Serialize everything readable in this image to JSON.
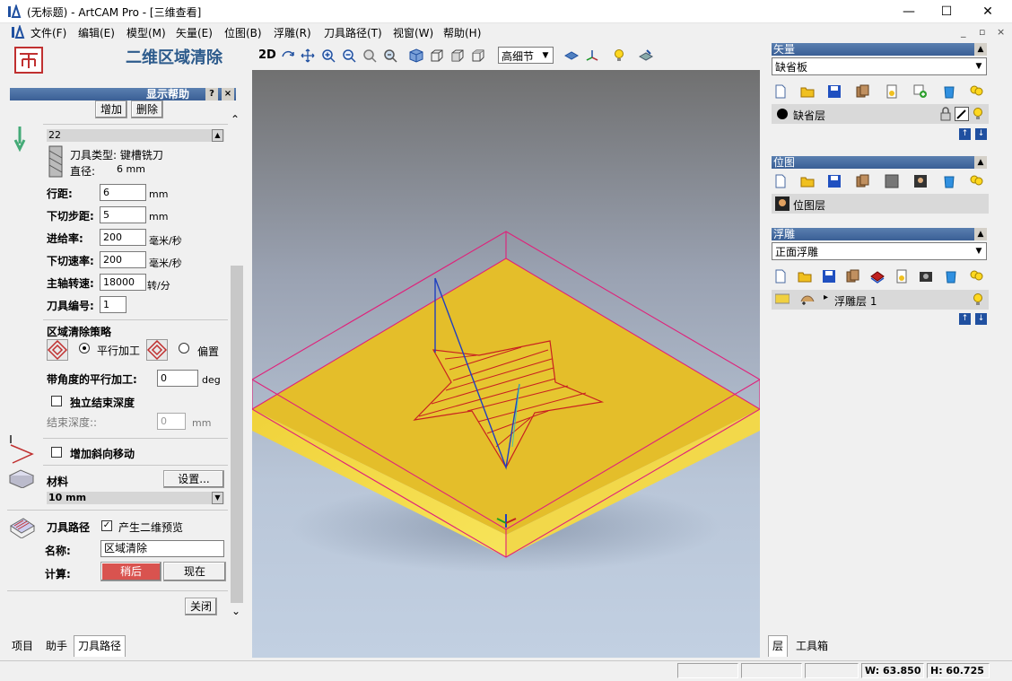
{
  "window": {
    "title": "(无标题) - ArtCAM Pro - [三维查看]",
    "minimize": "—",
    "maximize": "☐",
    "close": "✕"
  },
  "menu": {
    "items": [
      "文件(F)",
      "编辑(E)",
      "模型(M)",
      "矢量(E)",
      "位图(B)",
      "浮雕(R)",
      "刀具路径(T)",
      "视窗(W)",
      "帮助(H)"
    ],
    "mdi": [
      "_",
      "▫",
      "×"
    ]
  },
  "left": {
    "panel_title": "二维区域清除",
    "help_label": "显示帮助",
    "help_q": "?",
    "help_x": "×",
    "add_label": "增加",
    "delete_label": "删除",
    "tool_name": "22",
    "tool_type": "刀具类型: 键槽铣刀",
    "diameter_label": "直径:",
    "diameter_value": "6 mm",
    "stepover_label": "行距:",
    "stepover_value": "6",
    "stepover_unit": "mm",
    "stepdown_label": "下切步距:",
    "stepdown_value": "5",
    "stepdown_unit": "mm",
    "feed_label": "进给率:",
    "feed_value": "200",
    "feed_unit": "毫米/秒",
    "plunge_label": "下切速率:",
    "plunge_value": "200",
    "plunge_unit": "毫米/秒",
    "spindle_label": "主轴转速:",
    "spindle_value": "18000",
    "spindle_unit": "转/分",
    "toolno_label": "刀具编号:",
    "toolno_value": "1",
    "strategy_label": "区域清除策略",
    "raster_label": "平行加工",
    "offset_label": "偏置",
    "angle_label": "带角度的平行加工:",
    "angle_value": "0",
    "angle_unit": "deg",
    "indep_depth_label": "独立结束深度",
    "end_depth_label": "结束深度::",
    "end_depth_value": "0",
    "end_depth_unit": "mm",
    "ramp_label": "增加斜向移动",
    "material_label": "材料",
    "setup_label": "设置...",
    "material_value": "10 mm",
    "toolpath_label": "刀具路径",
    "preview_label": "产生二维预览",
    "name_label": "名称:",
    "name_value": "区域清除",
    "calc_label": "计算:",
    "later_label": "稍后",
    "now_label": "现在",
    "close_label": "关闭"
  },
  "left_tabs": [
    "项目",
    "助手",
    "刀具路径"
  ],
  "toolbar3d": {
    "mode_2d": "2D",
    "quality_value": "高细节"
  },
  "right": {
    "vector_title": "矢量",
    "vector_sheet": "缺省板",
    "vector_layer": "缺省层",
    "bitmap_title": "位图",
    "bitmap_layer": "位图层",
    "relief_title": "浮雕",
    "relief_mode": "正面浮雕",
    "relief_layer": "浮雕层 1"
  },
  "right_tabs": [
    "层",
    "工具箱"
  ],
  "status": {
    "width": "W: 63.850",
    "height": "H: 60.725"
  },
  "colors": {
    "later_button": "#d9534f",
    "panel_title": "#2d5b8c",
    "plate": "#e8c22e",
    "bbox": "#e0207a",
    "toolpath": "#d01010",
    "plunge": "#2040c0"
  }
}
